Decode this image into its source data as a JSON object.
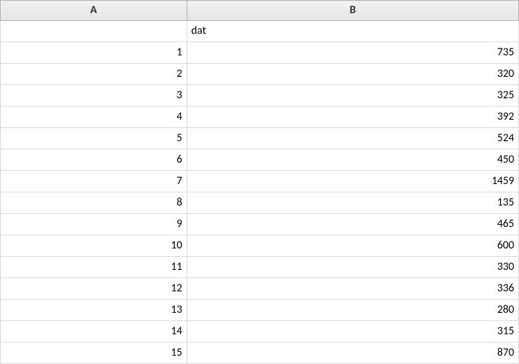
{
  "columns": {
    "a": "A",
    "b": "B"
  },
  "rows": [
    {
      "a": "",
      "b": "dat",
      "b_align": "left"
    },
    {
      "a": "1",
      "b": "735"
    },
    {
      "a": "2",
      "b": "320"
    },
    {
      "a": "3",
      "b": "325"
    },
    {
      "a": "4",
      "b": "392"
    },
    {
      "a": "5",
      "b": "524"
    },
    {
      "a": "6",
      "b": "450"
    },
    {
      "a": "7",
      "b": "1459"
    },
    {
      "a": "8",
      "b": "135"
    },
    {
      "a": "9",
      "b": "465"
    },
    {
      "a": "10",
      "b": "600"
    },
    {
      "a": "11",
      "b": "330"
    },
    {
      "a": "12",
      "b": "336"
    },
    {
      "a": "13",
      "b": "280"
    },
    {
      "a": "14",
      "b": "315"
    },
    {
      "a": "15",
      "b": "870"
    }
  ],
  "chart_data": {
    "type": "table",
    "columns": [
      "",
      "dat"
    ],
    "rows": [
      [
        1,
        735
      ],
      [
        2,
        320
      ],
      [
        3,
        325
      ],
      [
        4,
        392
      ],
      [
        5,
        524
      ],
      [
        6,
        450
      ],
      [
        7,
        1459
      ],
      [
        8,
        135
      ],
      [
        9,
        465
      ],
      [
        10,
        600
      ],
      [
        11,
        330
      ],
      [
        12,
        336
      ],
      [
        13,
        280
      ],
      [
        14,
        315
      ],
      [
        15,
        870
      ]
    ]
  }
}
